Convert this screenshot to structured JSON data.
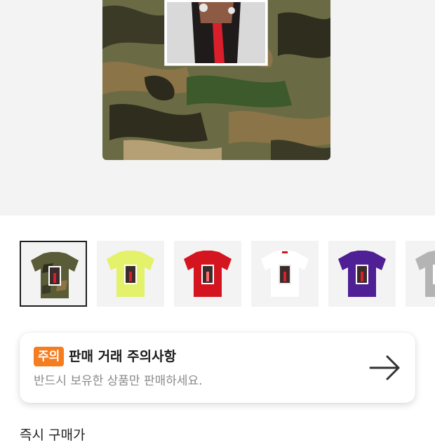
{
  "product": {
    "main_image": "camo-shirt-photo",
    "thumbnails": [
      {
        "name": "woodland-camo",
        "color": "#5a5b37",
        "selected": true
      },
      {
        "name": "lime",
        "color": "#e3f26a",
        "selected": false
      },
      {
        "name": "red",
        "color": "#d4141f",
        "selected": false
      },
      {
        "name": "white",
        "color": "#ffffff",
        "selected": false
      },
      {
        "name": "purple",
        "color": "#4f1f95",
        "selected": false
      },
      {
        "name": "grey",
        "color": "#b4b4b4",
        "selected": false
      }
    ]
  },
  "notice": {
    "badge": "주의",
    "title": "판매 거래 주의사항",
    "subtitle": "반드시 보유한 상품만 판매하세요.",
    "icon": "arrow-right-icon"
  },
  "seller_section": {
    "label": "즉시 구매가"
  },
  "colors": {
    "badge_bg": "#f57c1f",
    "hero_bg": "#f3f3f3",
    "thumb_border": "#1e1e1e"
  }
}
